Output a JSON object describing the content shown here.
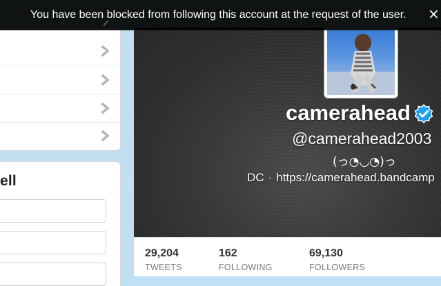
{
  "notification": {
    "message": "You have been blocked from following this account at the request of the user.",
    "close_glyph": "×"
  },
  "sidebar": {
    "nav_items_count_visible": 4,
    "who_to_follow_title": "ell"
  },
  "profile": {
    "name": "camerahead",
    "verified": true,
    "handle": "@camerahead2003",
    "bio": "(っ◔◡◔)っ",
    "location": "DC",
    "separator": "·",
    "url": "https://camerahead.bandcamp"
  },
  "stats": {
    "tweets": {
      "value": "29,204",
      "label": "TWEETS"
    },
    "following": {
      "value": "162",
      "label": "FOLLOWING"
    },
    "followers": {
      "value": "69,130",
      "label": "FOLLOWERS"
    }
  },
  "colors": {
    "verified_blue": "#1da1f2",
    "chevron_gray": "#b5b5b5",
    "header_dark": "#2c2c2c",
    "page_bg_blue": "#b9dcef"
  },
  "icons": {
    "nav_chevron": "chevron-right-icon",
    "verified": "verified-badge-icon",
    "close": "close-icon"
  }
}
